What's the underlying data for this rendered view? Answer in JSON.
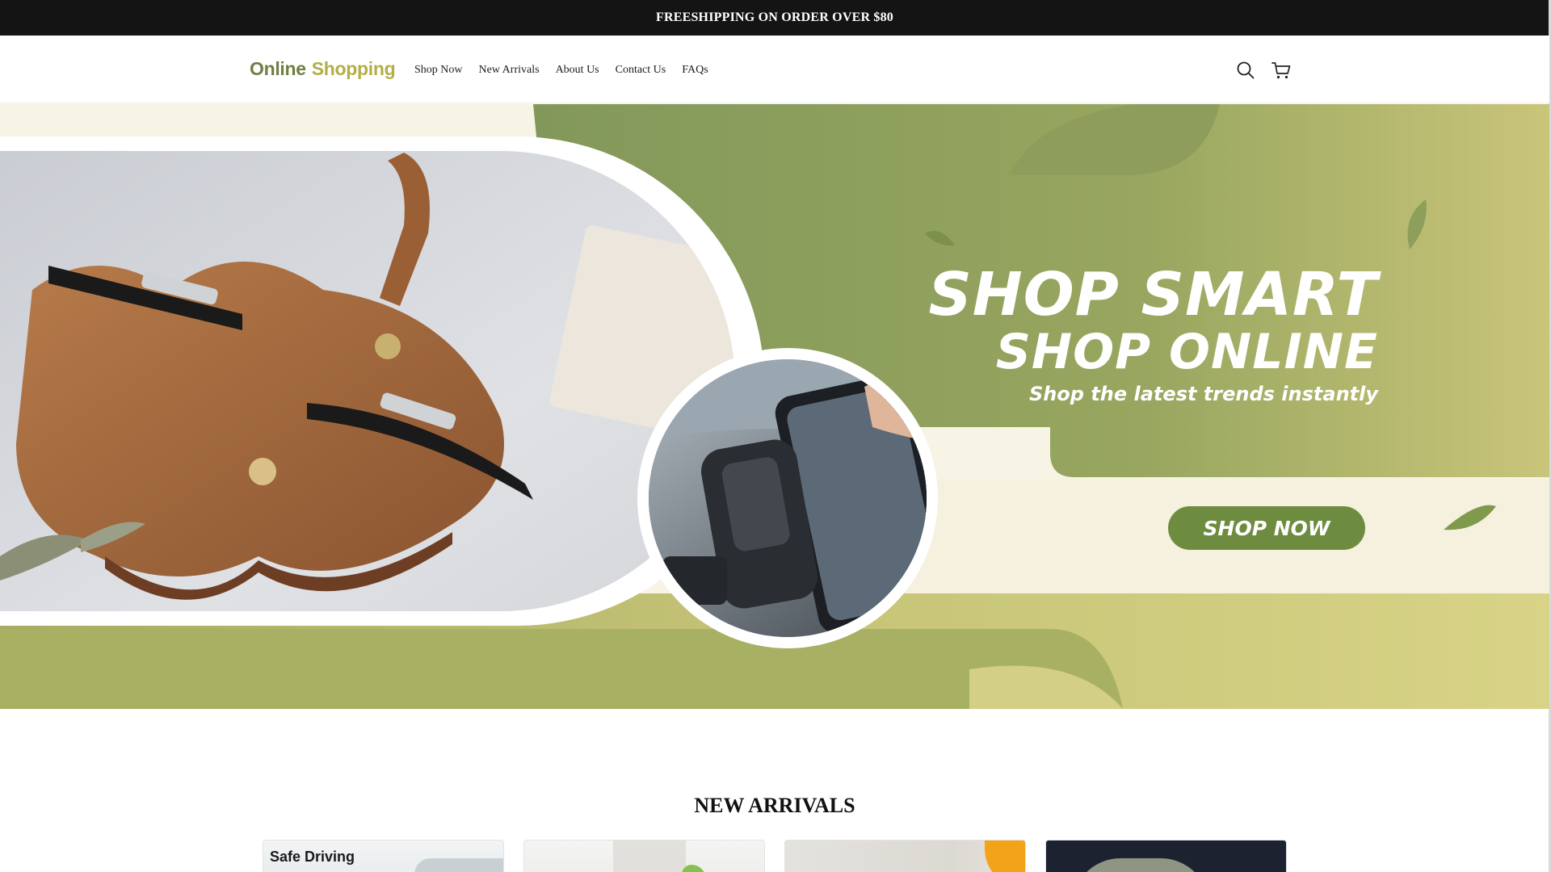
{
  "announcement": {
    "text": "FREESHIPPING ON ORDER OVER $80"
  },
  "header": {
    "logo": {
      "word1": "Online",
      "word2": "Shopping"
    },
    "nav": [
      {
        "label": "Shop Now"
      },
      {
        "label": "New Arrivals"
      },
      {
        "label": "About Us"
      },
      {
        "label": "Contact Us"
      },
      {
        "label": "FAQs"
      }
    ],
    "icons": {
      "search": "search-icon",
      "cart": "cart-icon"
    }
  },
  "hero": {
    "title_line1": "SHOP SMART",
    "title_line2": "SHOP ONLINE",
    "subtitle": "Shop the latest trends instantly",
    "cta_label": "SHOP NOW",
    "colors": {
      "olive": "#8a9a5b",
      "cream": "#f5f1de",
      "button": "#6e8c40",
      "leather": "#a0663a"
    }
  },
  "new_arrivals": {
    "title": "NEW ARRIVALS",
    "cards": [
      {
        "badge": "Safe Driving"
      },
      {
        "badge": ""
      },
      {
        "badge": ""
      },
      {
        "badge": ""
      }
    ]
  }
}
